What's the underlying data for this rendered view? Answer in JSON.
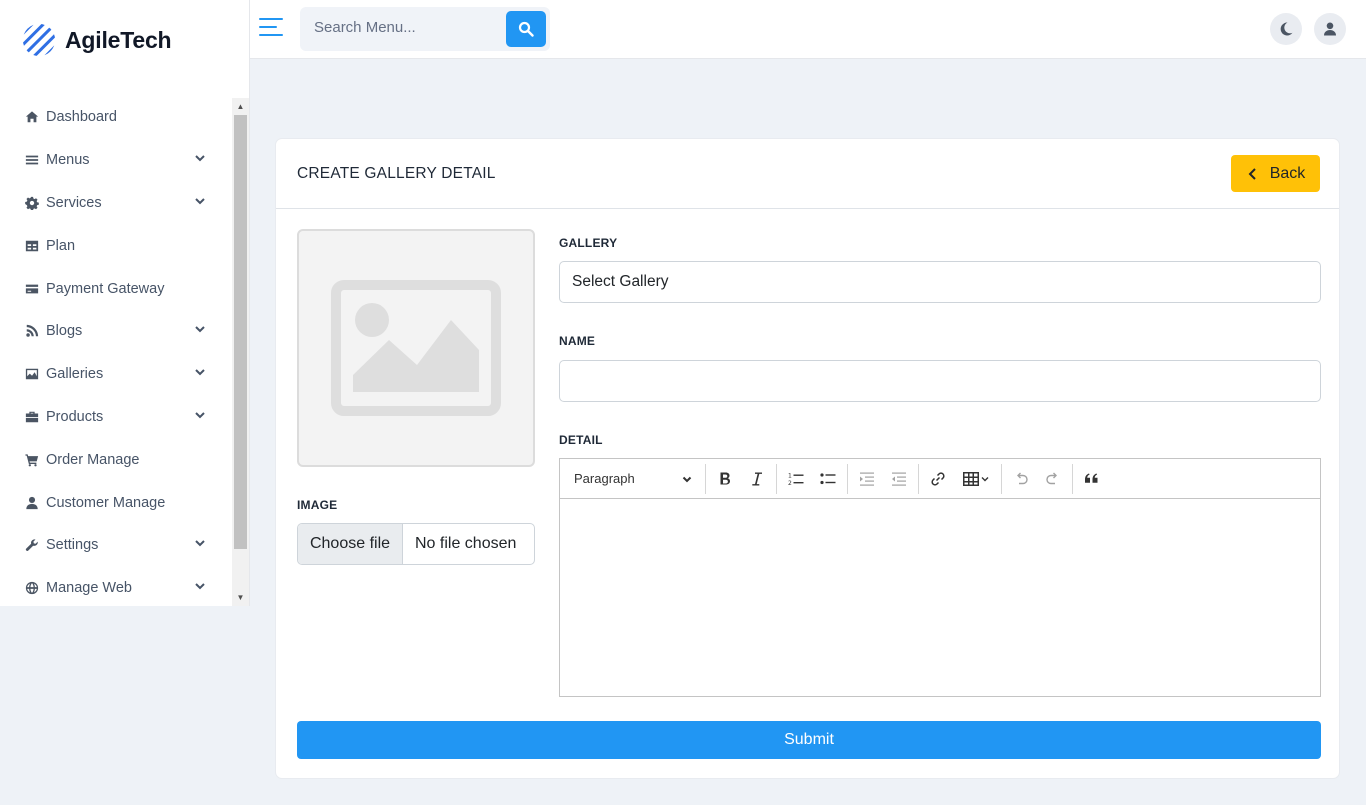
{
  "brand": {
    "name": "AgileTech"
  },
  "sidebar": {
    "items": [
      {
        "label": "Dashboard",
        "icon": "home-icon",
        "expandable": false
      },
      {
        "label": "Menus",
        "icon": "bars-icon",
        "expandable": true
      },
      {
        "label": "Services",
        "icon": "gear-icon",
        "expandable": true
      },
      {
        "label": "Plan",
        "icon": "table-icon",
        "expandable": false
      },
      {
        "label": "Payment Gateway",
        "icon": "credit-card-icon",
        "expandable": false
      },
      {
        "label": "Blogs",
        "icon": "blog-icon",
        "expandable": true
      },
      {
        "label": "Galleries",
        "icon": "image-icon",
        "expandable": true
      },
      {
        "label": "Products",
        "icon": "briefcase-icon",
        "expandable": true
      },
      {
        "label": "Order Manage",
        "icon": "cart-icon",
        "expandable": false
      },
      {
        "label": "Customer Manage",
        "icon": "user-icon",
        "expandable": false
      },
      {
        "label": "Settings",
        "icon": "wrench-icon",
        "expandable": true
      },
      {
        "label": "Manage Web",
        "icon": "globe-icon",
        "expandable": true
      }
    ]
  },
  "topbar": {
    "search_placeholder": "Search Menu...",
    "search_icon": "search-icon",
    "theme_icon": "moon-icon",
    "profile_icon": "user-icon"
  },
  "card": {
    "title": "CREATE GALLERY DETAIL",
    "back_label": "Back",
    "image_label": "IMAGE",
    "choose_file_label": "Choose file",
    "no_file_text": "No file chosen",
    "gallery_label": "GALLERY",
    "gallery_selected": "Select Gallery",
    "name_label": "NAME",
    "name_value": "",
    "detail_label": "DETAIL",
    "editor_block_style": "Paragraph",
    "submit_label": "Submit"
  },
  "colors": {
    "primary": "#2196f3",
    "warning": "#ffc107",
    "background": "#eef2f7"
  }
}
